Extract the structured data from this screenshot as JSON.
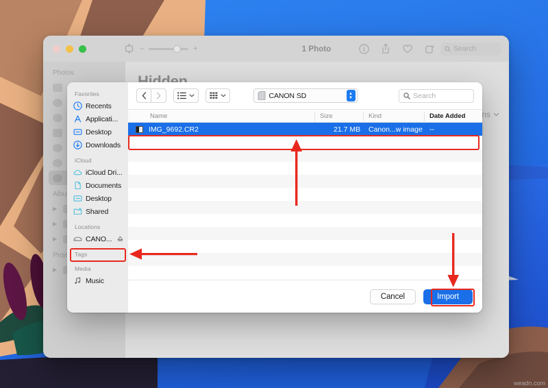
{
  "desktop": {
    "watermark": "weadn.com"
  },
  "photos_window": {
    "traffic_lights": [
      "close",
      "minimize",
      "zoom"
    ],
    "toolbar": {
      "zoom_minus": "–",
      "zoom_plus": "+",
      "photo_count": "1 Photo",
      "icons": [
        "info-icon",
        "share-icon",
        "heart-icon",
        "rotate-icon"
      ],
      "search_placeholder": "Search"
    },
    "sidebar": {
      "section_photos": "Photos",
      "section_albums": "Albums",
      "section_projects": "Projects"
    },
    "main": {
      "heading": "Hidden",
      "options_label": "ns"
    }
  },
  "file_dialog": {
    "toolbar": {
      "back_label": "‹",
      "forward_label": "›",
      "path_label": "CANON SD",
      "search_placeholder": "Search"
    },
    "sidebar": {
      "sections": [
        {
          "title": "Favorites",
          "items": [
            {
              "label": "Recents",
              "icon": "clock-icon"
            },
            {
              "label": "Applicati...",
              "icon": "applications-icon"
            },
            {
              "label": "Desktop",
              "icon": "desktop-icon"
            },
            {
              "label": "Downloads",
              "icon": "downloads-icon"
            }
          ]
        },
        {
          "title": "iCloud",
          "items": [
            {
              "label": "iCloud Dri...",
              "icon": "cloud-icon"
            },
            {
              "label": "Documents",
              "icon": "document-icon"
            },
            {
              "label": "Desktop",
              "icon": "desktop-icon"
            },
            {
              "label": "Shared",
              "icon": "shared-folder-icon"
            }
          ]
        },
        {
          "title": "Locations",
          "items": [
            {
              "label": "CANO...",
              "icon": "external-drive-icon",
              "eject": true
            }
          ]
        },
        {
          "title": "Tags",
          "items": []
        },
        {
          "title": "Media",
          "items": [
            {
              "label": "Music",
              "icon": "music-note-icon"
            }
          ]
        }
      ]
    },
    "columns": [
      "Name",
      "Size",
      "Kind",
      "Date Added"
    ],
    "rows": [
      {
        "name": "IMG_9692.CR2",
        "size": "21.7 MB",
        "kind": "Canon...w image",
        "date_added": "--",
        "selected": true
      }
    ],
    "footer": {
      "cancel_label": "Cancel",
      "import_label": "Import"
    }
  },
  "annotations": {
    "highlight_color": "#e8281e",
    "arrows": [
      {
        "name": "arrow-to-file-row",
        "direction": "up"
      },
      {
        "name": "arrow-to-canon-sidebar",
        "direction": "left"
      },
      {
        "name": "arrow-to-import-button",
        "direction": "down"
      }
    ]
  }
}
